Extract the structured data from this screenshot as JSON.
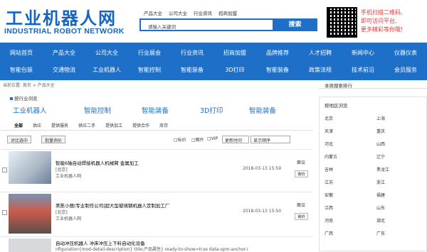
{
  "header": {
    "logo_cn": "工业机器人网",
    "logo_en": "INDUSTRIAL ROBOT NETWORK",
    "top_links": [
      "产品大全",
      "公司大全",
      "行业资讯",
      "招商加盟"
    ],
    "search_placeholder": "请输入关键词",
    "search_button": "搜索",
    "qr_text": [
      "手机扫描二维码,",
      "即可访问平台,",
      "更多精彩等你哦!"
    ]
  },
  "nav": {
    "row1": [
      "网站首页",
      "产品大全",
      "公司大全",
      "行业展会",
      "行业资讯",
      "招商加盟",
      "品牌推荐",
      "人才招聘",
      "新闻中心",
      "仪器仪表"
    ],
    "row2": [
      "智能包装",
      "交通物流",
      "工业机器人",
      "智能控制",
      "智能装备",
      "3D打印",
      "智能装备",
      "政策法规",
      "技术前沿",
      "会员服务"
    ]
  },
  "breadcrumb": "当前位置: 首页 > 产品大全",
  "hot": {
    "title": "按行业浏览",
    "cats": [
      "工业机器人",
      "智能控制",
      "智能装备",
      "3D打印",
      "智能装备"
    ]
  },
  "filter_tabs": [
    "全部",
    "供应",
    "提供服务",
    "供应二手",
    "提供加工",
    "提供合作",
    "库存"
  ],
  "toolbar": {
    "compare": "对比选中",
    "favorite": "批量询价",
    "checks": [
      "标价",
      "图片",
      "VIP"
    ],
    "sort1": "更新时间",
    "sort2": "显示顺序"
  },
  "items": [
    {
      "title": "智能6轴自动焊接机器人机械臂 金属加工",
      "sub1": "[北京]",
      "sub2": "工业机器人网",
      "date": "2018-03-13 15:59",
      "price": "面议",
      "rate": "询价"
    },
    {
      "title": "美陈小丽|专业制作公司|超大型玻璃钢机器人定制加工厂",
      "sub1": "[北京]",
      "sub2": "工业机器人网",
      "date": "2018-03-13 15:50",
      "price": "面议",
      "rate": "询价"
    },
    {
      "title": "自动冲压机器人 冲床冲压上下料自动化设备",
      "sub1": "nfiguration{mod-detail-description} title;产品属性} ready-to-show=true data-spm-anchor-i",
      "sub2": "",
      "date": "",
      "price": "",
      "rate": ""
    }
  ],
  "sidebar": {
    "title1": "本周搜索排行",
    "title2": "按地区浏览",
    "regions_left": [
      "北京",
      "天津",
      "河北",
      "内蒙古",
      "吉林",
      "江苏",
      "安徽",
      "江西",
      "河南",
      "广西"
    ],
    "regions_right": [
      "上海",
      "重庆",
      "山西",
      "辽宁",
      "黑龙江",
      "浙江",
      "福建",
      "山东",
      "湖北",
      "广东"
    ]
  }
}
